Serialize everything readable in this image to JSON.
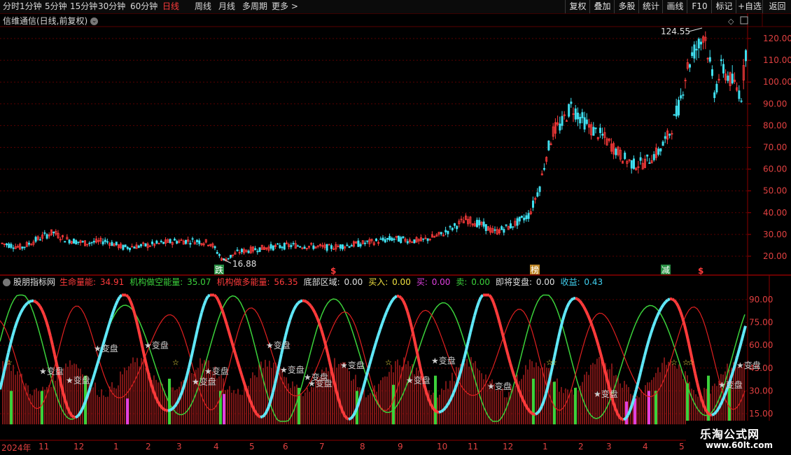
{
  "toolbar": {
    "periods": [
      "分时",
      "1分钟",
      "5分钟",
      "15分钟",
      "30分钟",
      "60分钟",
      "日线",
      "周线",
      "月线",
      "多周期",
      "更多 >"
    ],
    "active_period": "日线",
    "right_buttons": [
      "复权",
      "叠加",
      "多股",
      "统计",
      "画线",
      "F10",
      "标记",
      "+自选",
      "返回"
    ]
  },
  "main_chart": {
    "title": "信维通信(日线,前复权)",
    "high_label": "124.55",
    "low_label": "16.88",
    "y_ticks": [
      "120.00",
      "110.00",
      "100.00",
      "90.00",
      "80.00",
      "70.00",
      "60.00",
      "50.00",
      "40.00",
      "30.00",
      "20.00"
    ],
    "markers": [
      {
        "text": "跌",
        "color": "#2fa84f"
      },
      {
        "text": "$",
        "color": "#ff3b3b"
      },
      {
        "text": "榜",
        "color": "#e0a030"
      },
      {
        "text": "减",
        "color": "#2fa84f"
      },
      {
        "text": "$",
        "color": "#ff3b3b"
      }
    ]
  },
  "indicator": {
    "name": "股朋指标网",
    "items": [
      {
        "label": "生命量能: ",
        "value": "34.91",
        "color": "#ff3b3b"
      },
      {
        "label": "机构做空能量: ",
        "value": "35.07",
        "color": "#3bd23b"
      },
      {
        "label": "机构做多能量: ",
        "value": "56.35",
        "color": "#ff3b3b"
      },
      {
        "label": "底部区域: ",
        "value": "0.00",
        "color": "#e0e0e0"
      },
      {
        "label": "买入: ",
        "value": "0.00",
        "color": "#f0e040"
      },
      {
        "label": "买: ",
        "value": "0.00",
        "color": "#e040e0"
      },
      {
        "label": "卖: ",
        "value": "0.00",
        "color": "#3bd23b"
      },
      {
        "label": "即将变盘: ",
        "value": "0.00",
        "color": "#e0e0e0"
      },
      {
        "label": "收益: ",
        "value": "0.43",
        "color": "#40d0f0"
      }
    ],
    "y_ticks": [
      "90.00",
      "75.00",
      "60.00",
      "45.00",
      "30.00",
      "15.00"
    ],
    "change_label": "变盘"
  },
  "date_axis": [
    "2024年",
    "11",
    "12",
    "1",
    "2",
    "3",
    "4",
    "5",
    "6",
    "7",
    "8",
    "9",
    "10",
    "11",
    "12",
    "1",
    "2",
    "3",
    "4",
    "5"
  ],
  "watermark": {
    "title": "乐淘公式网",
    "url": "www.60lt.com"
  },
  "colors": {
    "up": "#ff3b3b",
    "down": "#40e0f0",
    "grid": "#5a0000",
    "short": "#3bd23b",
    "long": "#e02020"
  }
}
